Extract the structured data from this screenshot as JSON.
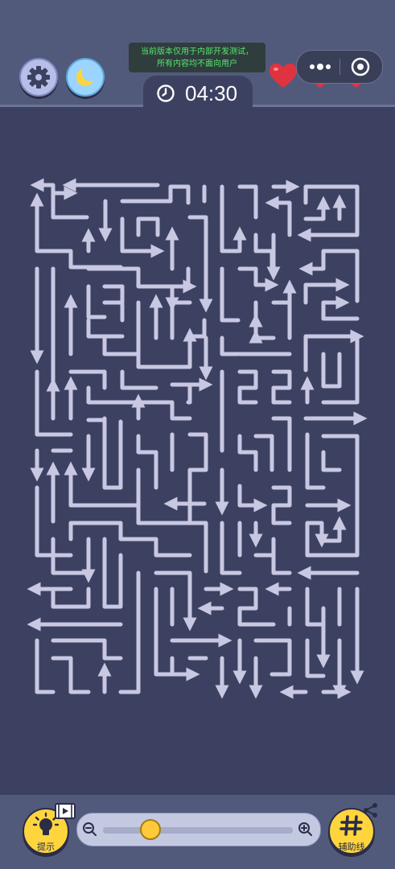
{
  "notice": {
    "line1": "当前版本仅用于内部开发测试，",
    "line2": "所有内容均不面向用户"
  },
  "timer": {
    "value": "04:30"
  },
  "lives": {
    "count": 3
  },
  "toolbar": {
    "hint_label": "提示",
    "aux_label": "辅助线"
  },
  "zoom": {
    "level": 0.25
  },
  "colors": {
    "background": "#3d4161",
    "maze_path": "#c8c8e2",
    "accent": "#ffd53d",
    "heart": "#e03340",
    "notice_text": "#55e86d"
  },
  "icons": [
    "gear-icon",
    "moon-icon",
    "clock-icon",
    "more-icon",
    "record-icon",
    "heart-icon",
    "lightbulb-icon",
    "video-icon",
    "zoom-out-icon",
    "zoom-in-icon",
    "grid-icon",
    "share-icon"
  ]
}
